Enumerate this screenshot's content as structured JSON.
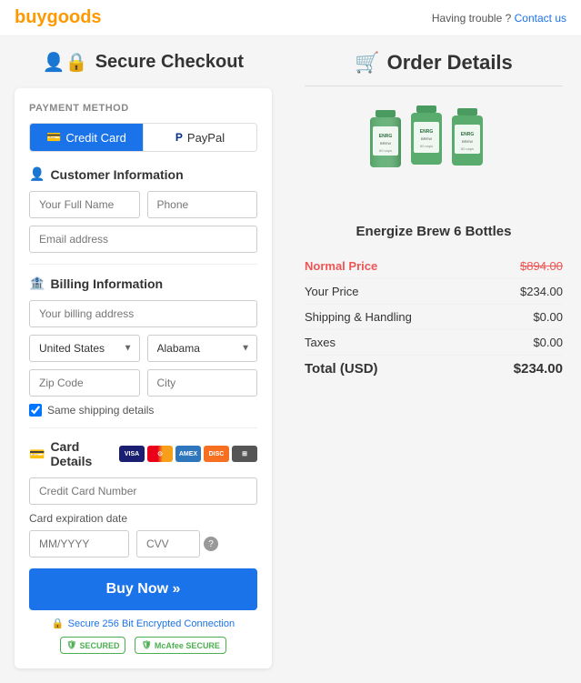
{
  "header": {
    "logo": "buygoods",
    "trouble_text": "Having trouble ?",
    "contact_text": "Contact us"
  },
  "left": {
    "title": "Secure Checkout",
    "payment_method_label": "PAYMENT METHOD",
    "tabs": [
      {
        "id": "credit-card",
        "label": "Credit Card",
        "active": true
      },
      {
        "id": "paypal",
        "label": "PayPal",
        "active": false
      }
    ],
    "customer_info": {
      "heading": "Customer Information",
      "full_name_placeholder": "Your Full Name",
      "phone_placeholder": "Phone",
      "email_placeholder": "Email address"
    },
    "billing_info": {
      "heading": "Billing Information",
      "address_placeholder": "Your billing address",
      "country_options": [
        "United States"
      ],
      "country_selected": "United States",
      "state_options": [
        "Alabama"
      ],
      "state_selected": "Alabama",
      "zip_placeholder": "Zip Code",
      "city_placeholder": "City",
      "same_shipping_label": "Same shipping details"
    },
    "card_details": {
      "heading": "Card Details",
      "card_number_placeholder": "Credit Card Number",
      "expiry_label": "Card expiration date",
      "expiry_placeholder": "MM/YYYY",
      "cvv_placeholder": "CVV"
    },
    "buy_button": "Buy Now »",
    "secure_text": "Secure 256 Bit Encrypted Connection",
    "badge1": "SECURED",
    "badge2": "McAfee SECURE"
  },
  "right": {
    "title": "Order Details",
    "product_name": "Energize Brew 6 Bottles",
    "prices": [
      {
        "label": "Normal Price",
        "value": "$894.00",
        "type": "normal"
      },
      {
        "label": "Your Price",
        "value": "$234.00",
        "type": "regular"
      },
      {
        "label": "Shipping & Handling",
        "value": "$0.00",
        "type": "regular"
      },
      {
        "label": "Taxes",
        "value": "$0.00",
        "type": "regular"
      },
      {
        "label": "Total (USD)",
        "value": "$234.00",
        "type": "total"
      }
    ]
  }
}
